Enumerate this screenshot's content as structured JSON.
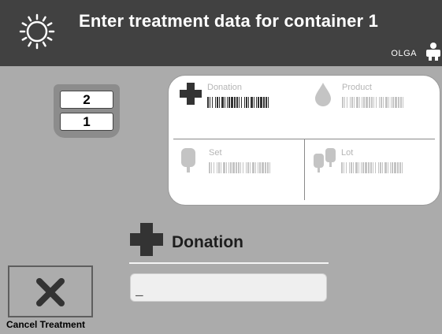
{
  "header": {
    "title": "Enter treatment data for container 1",
    "user": "OLGA",
    "status_icon": "sun-icon",
    "user_icon": "person-icon"
  },
  "container_stack": {
    "tabs": [
      "2",
      "1"
    ]
  },
  "summary": {
    "donation_label": "Donation",
    "product_label": "Product",
    "set_label": "Set",
    "lot_label": "Lot"
  },
  "entry": {
    "label": "Donation",
    "value": "_"
  },
  "cancel": {
    "label": "Cancel Treatment"
  },
  "colors": {
    "background": "#ababab",
    "header": "#414141",
    "card": "#ffffff",
    "icon_dark": "#333333",
    "icon_light": "#c4c4c4"
  }
}
